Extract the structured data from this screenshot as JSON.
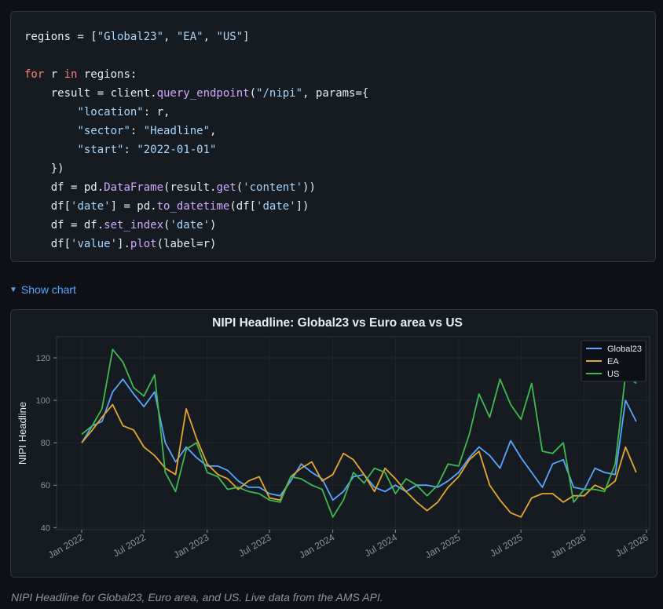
{
  "code": {
    "lines": [
      [
        {
          "t": "regions = ["
        },
        {
          "t": "\"Global23\"",
          "c": "str"
        },
        {
          "t": ", "
        },
        {
          "t": "\"EA\"",
          "c": "str"
        },
        {
          "t": ", "
        },
        {
          "t": "\"US\"",
          "c": "str"
        },
        {
          "t": "]"
        }
      ],
      [],
      [
        {
          "t": "for",
          "c": "kw"
        },
        {
          "t": " r "
        },
        {
          "t": "in",
          "c": "kw"
        },
        {
          "t": " regions:"
        }
      ],
      [
        {
          "t": "    result = client."
        },
        {
          "t": "query_endpoint",
          "c": "fn"
        },
        {
          "t": "("
        },
        {
          "t": "\"/nipi\"",
          "c": "str"
        },
        {
          "t": ", params={"
        }
      ],
      [
        {
          "t": "        "
        },
        {
          "t": "\"location\"",
          "c": "str"
        },
        {
          "t": ": r,"
        }
      ],
      [
        {
          "t": "        "
        },
        {
          "t": "\"sector\"",
          "c": "str"
        },
        {
          "t": ": "
        },
        {
          "t": "\"Headline\"",
          "c": "str"
        },
        {
          "t": ","
        }
      ],
      [
        {
          "t": "        "
        },
        {
          "t": "\"start\"",
          "c": "str"
        },
        {
          "t": ": "
        },
        {
          "t": "\"2022-01-01\"",
          "c": "str"
        }
      ],
      [
        {
          "t": "    })"
        }
      ],
      [
        {
          "t": "    df = pd."
        },
        {
          "t": "DataFrame",
          "c": "fn"
        },
        {
          "t": "(result."
        },
        {
          "t": "get",
          "c": "fn"
        },
        {
          "t": "("
        },
        {
          "t": "'content'",
          "c": "str"
        },
        {
          "t": "))"
        }
      ],
      [
        {
          "t": "    df["
        },
        {
          "t": "'date'",
          "c": "str"
        },
        {
          "t": "] = pd."
        },
        {
          "t": "to_datetime",
          "c": "fn"
        },
        {
          "t": "(df["
        },
        {
          "t": "'date'",
          "c": "str"
        },
        {
          "t": "])"
        }
      ],
      [
        {
          "t": "    df = df."
        },
        {
          "t": "set_index",
          "c": "fn"
        },
        {
          "t": "("
        },
        {
          "t": "'date'",
          "c": "str"
        },
        {
          "t": ")"
        }
      ],
      [
        {
          "t": "    df["
        },
        {
          "t": "'value'",
          "c": "str"
        },
        {
          "t": "]."
        },
        {
          "t": "plot",
          "c": "fn"
        },
        {
          "t": "(label=r)"
        }
      ]
    ]
  },
  "toggle": {
    "icon": "triangle-down-icon",
    "label": "Show chart"
  },
  "caption": "NIPI Headline for Global23, Euro area, and US. Live data from the AMS API.",
  "chart_data": {
    "type": "line",
    "title": "NIPI Headline: Global23 vs Euro area vs US",
    "xlabel": "",
    "ylabel": "NIPI Headline",
    "ylim": [
      39,
      130
    ],
    "xlim": [
      "2021-10-20",
      "2026-07-10"
    ],
    "yticks": [
      40,
      60,
      80,
      100,
      120
    ],
    "xticks": [
      {
        "date": "2022-01-01",
        "label": "Jan 2022"
      },
      {
        "date": "2022-07-01",
        "label": "Jul 2022"
      },
      {
        "date": "2023-01-01",
        "label": "Jan 2023"
      },
      {
        "date": "2023-07-01",
        "label": "Jul 2023"
      },
      {
        "date": "2024-01-01",
        "label": "Jan 2024"
      },
      {
        "date": "2024-07-01",
        "label": "Jul 2024"
      },
      {
        "date": "2025-01-01",
        "label": "Jan 2025"
      },
      {
        "date": "2025-07-01",
        "label": "Jul 2025"
      },
      {
        "date": "2026-01-01",
        "label": "Jan 2026"
      },
      {
        "date": "2026-07-01",
        "label": "Jul 2026"
      }
    ],
    "grid": true,
    "legend": "top-right",
    "series": [
      {
        "name": "Global23",
        "color": "#58a6ff",
        "points": [
          [
            "2022-01-01",
            80
          ],
          [
            "2022-02-01",
            88
          ],
          [
            "2022-03-01",
            90
          ],
          [
            "2022-04-01",
            104
          ],
          [
            "2022-05-01",
            110
          ],
          [
            "2022-06-01",
            103
          ],
          [
            "2022-07-01",
            97
          ],
          [
            "2022-08-01",
            104
          ],
          [
            "2022-09-01",
            80
          ],
          [
            "2022-10-01",
            71
          ],
          [
            "2022-11-01",
            78
          ],
          [
            "2022-12-01",
            73
          ],
          [
            "2023-01-01",
            69
          ],
          [
            "2023-02-01",
            69
          ],
          [
            "2023-03-01",
            67
          ],
          [
            "2023-04-01",
            62
          ],
          [
            "2023-05-01",
            59
          ],
          [
            "2023-06-01",
            59
          ],
          [
            "2023-07-01",
            56
          ],
          [
            "2023-08-01",
            55
          ],
          [
            "2023-09-01",
            62
          ],
          [
            "2023-10-01",
            70
          ],
          [
            "2023-11-01",
            66
          ],
          [
            "2023-12-01",
            63
          ],
          [
            "2024-01-01",
            53
          ],
          [
            "2024-02-01",
            57
          ],
          [
            "2024-03-01",
            64
          ],
          [
            "2024-04-01",
            65
          ],
          [
            "2024-05-01",
            59
          ],
          [
            "2024-06-01",
            57
          ],
          [
            "2024-07-01",
            60
          ],
          [
            "2024-08-01",
            57
          ],
          [
            "2024-09-01",
            60
          ],
          [
            "2024-10-01",
            60
          ],
          [
            "2024-11-01",
            59
          ],
          [
            "2024-12-01",
            62
          ],
          [
            "2025-01-01",
            66
          ],
          [
            "2025-02-01",
            73
          ],
          [
            "2025-03-01",
            78
          ],
          [
            "2025-04-01",
            74
          ],
          [
            "2025-05-01",
            68
          ],
          [
            "2025-06-01",
            81
          ],
          [
            "2025-07-01",
            73
          ],
          [
            "2025-08-01",
            66
          ],
          [
            "2025-09-01",
            59
          ],
          [
            "2025-10-01",
            70
          ],
          [
            "2025-11-01",
            72
          ],
          [
            "2025-12-01",
            59
          ],
          [
            "2026-01-01",
            58
          ],
          [
            "2026-02-01",
            68
          ],
          [
            "2026-03-01",
            66
          ],
          [
            "2026-04-01",
            65
          ],
          [
            "2026-05-01",
            100
          ],
          [
            "2026-06-01",
            90
          ]
        ]
      },
      {
        "name": "EA",
        "color": "#e3a72f",
        "points": [
          [
            "2022-01-01",
            80
          ],
          [
            "2022-02-01",
            86
          ],
          [
            "2022-03-01",
            92
          ],
          [
            "2022-04-01",
            98
          ],
          [
            "2022-05-01",
            88
          ],
          [
            "2022-06-01",
            86
          ],
          [
            "2022-07-01",
            78
          ],
          [
            "2022-08-01",
            74
          ],
          [
            "2022-09-01",
            68
          ],
          [
            "2022-10-01",
            65
          ],
          [
            "2022-11-01",
            96
          ],
          [
            "2022-12-01",
            82
          ],
          [
            "2023-01-01",
            70
          ],
          [
            "2023-02-01",
            65
          ],
          [
            "2023-03-01",
            63
          ],
          [
            "2023-04-01",
            58
          ],
          [
            "2023-05-01",
            62
          ],
          [
            "2023-06-01",
            64
          ],
          [
            "2023-07-01",
            54
          ],
          [
            "2023-08-01",
            53
          ],
          [
            "2023-09-01",
            64
          ],
          [
            "2023-10-01",
            68
          ],
          [
            "2023-11-01",
            71
          ],
          [
            "2023-12-01",
            62
          ],
          [
            "2024-01-01",
            65
          ],
          [
            "2024-02-01",
            75
          ],
          [
            "2024-03-01",
            72
          ],
          [
            "2024-04-01",
            65
          ],
          [
            "2024-05-01",
            57
          ],
          [
            "2024-06-01",
            68
          ],
          [
            "2024-07-01",
            63
          ],
          [
            "2024-08-01",
            57
          ],
          [
            "2024-09-01",
            52
          ],
          [
            "2024-10-01",
            48
          ],
          [
            "2024-11-01",
            52
          ],
          [
            "2024-12-01",
            59
          ],
          [
            "2025-01-01",
            64
          ],
          [
            "2025-02-01",
            72
          ],
          [
            "2025-03-01",
            76
          ],
          [
            "2025-04-01",
            60
          ],
          [
            "2025-05-01",
            53
          ],
          [
            "2025-06-01",
            47
          ],
          [
            "2025-07-01",
            45
          ],
          [
            "2025-08-01",
            54
          ],
          [
            "2025-09-01",
            56
          ],
          [
            "2025-10-01",
            56
          ],
          [
            "2025-11-01",
            52
          ],
          [
            "2025-12-01",
            55
          ],
          [
            "2026-01-01",
            55
          ],
          [
            "2026-02-01",
            60
          ],
          [
            "2026-03-01",
            58
          ],
          [
            "2026-04-01",
            62
          ],
          [
            "2026-05-01",
            78
          ],
          [
            "2026-06-01",
            66
          ]
        ]
      },
      {
        "name": "US",
        "color": "#3fb950",
        "points": [
          [
            "2022-01-01",
            84
          ],
          [
            "2022-02-01",
            88
          ],
          [
            "2022-03-01",
            96
          ],
          [
            "2022-04-01",
            124
          ],
          [
            "2022-05-01",
            118
          ],
          [
            "2022-06-01",
            106
          ],
          [
            "2022-07-01",
            102
          ],
          [
            "2022-08-01",
            112
          ],
          [
            "2022-09-01",
            66
          ],
          [
            "2022-10-01",
            57
          ],
          [
            "2022-11-01",
            77
          ],
          [
            "2022-12-01",
            80
          ],
          [
            "2023-01-01",
            66
          ],
          [
            "2023-02-01",
            64
          ],
          [
            "2023-03-01",
            58
          ],
          [
            "2023-04-01",
            59
          ],
          [
            "2023-05-01",
            57
          ],
          [
            "2023-06-01",
            56
          ],
          [
            "2023-07-01",
            53
          ],
          [
            "2023-08-01",
            52
          ],
          [
            "2023-09-01",
            64
          ],
          [
            "2023-10-01",
            63
          ],
          [
            "2023-11-01",
            60
          ],
          [
            "2023-12-01",
            58
          ],
          [
            "2024-01-01",
            45
          ],
          [
            "2024-02-01",
            53
          ],
          [
            "2024-03-01",
            66
          ],
          [
            "2024-04-01",
            61
          ],
          [
            "2024-05-01",
            68
          ],
          [
            "2024-06-01",
            66
          ],
          [
            "2024-07-01",
            56
          ],
          [
            "2024-08-01",
            63
          ],
          [
            "2024-09-01",
            60
          ],
          [
            "2024-10-01",
            55
          ],
          [
            "2024-11-01",
            60
          ],
          [
            "2024-12-01",
            70
          ],
          [
            "2025-01-01",
            69
          ],
          [
            "2025-02-01",
            84
          ],
          [
            "2025-03-01",
            103
          ],
          [
            "2025-04-01",
            92
          ],
          [
            "2025-05-01",
            110
          ],
          [
            "2025-06-01",
            98
          ],
          [
            "2025-07-01",
            91
          ],
          [
            "2025-08-01",
            108
          ],
          [
            "2025-09-01",
            76
          ],
          [
            "2025-10-01",
            75
          ],
          [
            "2025-11-01",
            80
          ],
          [
            "2025-12-01",
            52
          ],
          [
            "2026-01-01",
            58
          ],
          [
            "2026-02-01",
            58
          ],
          [
            "2026-03-01",
            57
          ],
          [
            "2026-04-01",
            70
          ],
          [
            "2026-05-01",
            112
          ],
          [
            "2026-06-01",
            108
          ]
        ]
      }
    ]
  }
}
